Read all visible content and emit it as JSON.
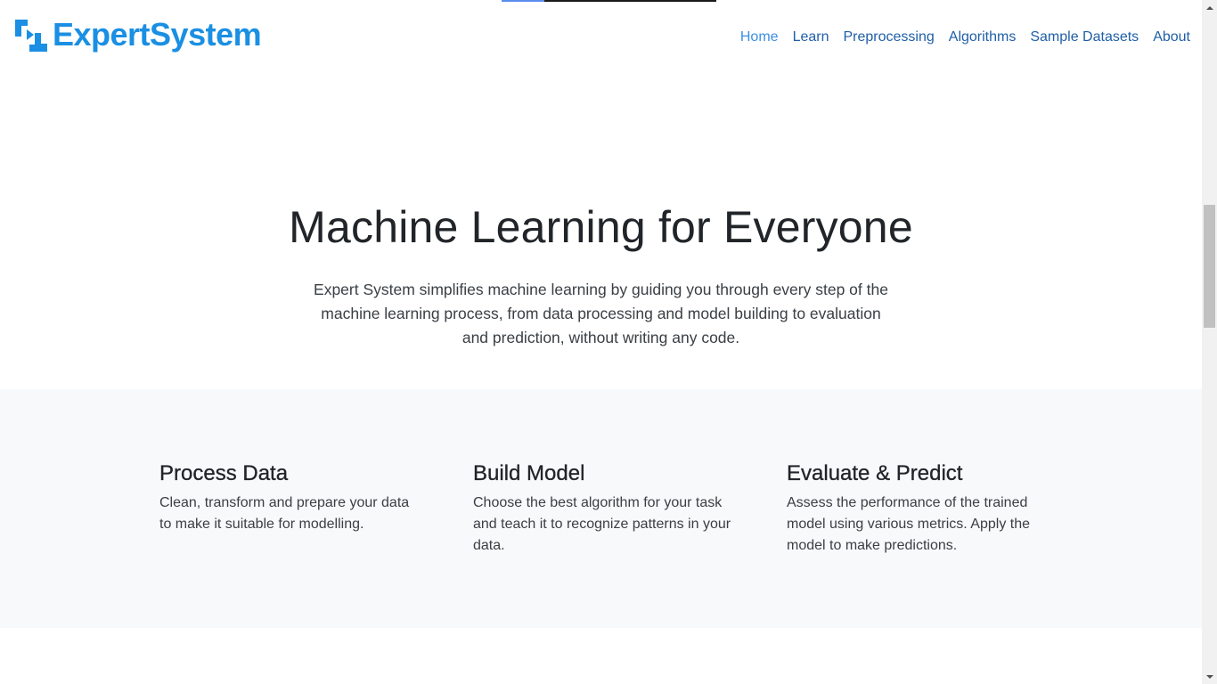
{
  "brand": {
    "name": "ExpertSystem",
    "color": "#1a8fe3",
    "icon": "expertsystem-logo-icon"
  },
  "nav": {
    "items": [
      {
        "label": "Home",
        "active": true
      },
      {
        "label": "Learn",
        "active": false
      },
      {
        "label": "Preprocessing",
        "active": false
      },
      {
        "label": "Algorithms",
        "active": false
      },
      {
        "label": "Sample Datasets",
        "active": false
      },
      {
        "label": "About",
        "active": false
      }
    ],
    "link_color": "#1f5fa8",
    "active_color": "#3c8ee3"
  },
  "hero": {
    "title": "Machine Learning for Everyone",
    "lead": "Expert System simplifies machine learning by guiding you through every step of the machine learning process, from data processing and model building to evaluation and prediction, without writing any code."
  },
  "features": [
    {
      "title": "Process Data",
      "text": "Clean, transform and prepare your data to make it suitable for modelling."
    },
    {
      "title": "Build Model",
      "text": "Choose the best algorithm for your task and teach it to recognize patterns in your data."
    },
    {
      "title": "Evaluate & Predict",
      "text": "Assess the performance of the trained model using various metrics. Apply the model to make predictions."
    }
  ],
  "loading_progress": 0.2,
  "colors": {
    "features_bg": "#f8f9fa",
    "text": "#212529"
  }
}
